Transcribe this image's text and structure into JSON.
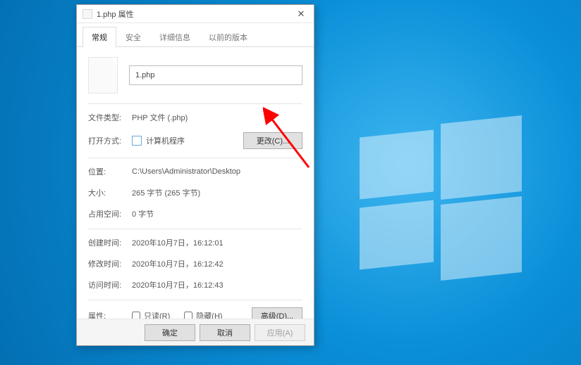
{
  "dialog": {
    "title": "1.php 属性",
    "tabs": [
      "常规",
      "安全",
      "详细信息",
      "以前的版本"
    ],
    "active_tab_index": 0,
    "filename": "1.php",
    "fields": {
      "file_type": {
        "label": "文件类型:",
        "value": "PHP 文件 (.php)"
      },
      "open_with": {
        "label": "打开方式:",
        "app": "计算机程序",
        "change_btn": "更改(C)..."
      },
      "location": {
        "label": "位置:",
        "value": "C:\\Users\\Administrator\\Desktop"
      },
      "size": {
        "label": "大小:",
        "value": "265 字节 (265 字节)"
      },
      "size_on_disk": {
        "label": "占用空间:",
        "value": "0 字节"
      },
      "created": {
        "label": "创建时间:",
        "value": "2020年10月7日，16:12:01"
      },
      "modified": {
        "label": "修改时间:",
        "value": "2020年10月7日，16:12:42"
      },
      "accessed": {
        "label": "访问时间:",
        "value": "2020年10月7日，16:12:43"
      },
      "attributes": {
        "label": "属性:",
        "readonly": "只读(R)",
        "hidden": "隐藏(H)",
        "advanced_btn": "高级(D)..."
      }
    },
    "footer": {
      "ok": "确定",
      "cancel": "取消",
      "apply": "应用(A)"
    }
  },
  "annotation": {
    "color": "#ff0000"
  }
}
